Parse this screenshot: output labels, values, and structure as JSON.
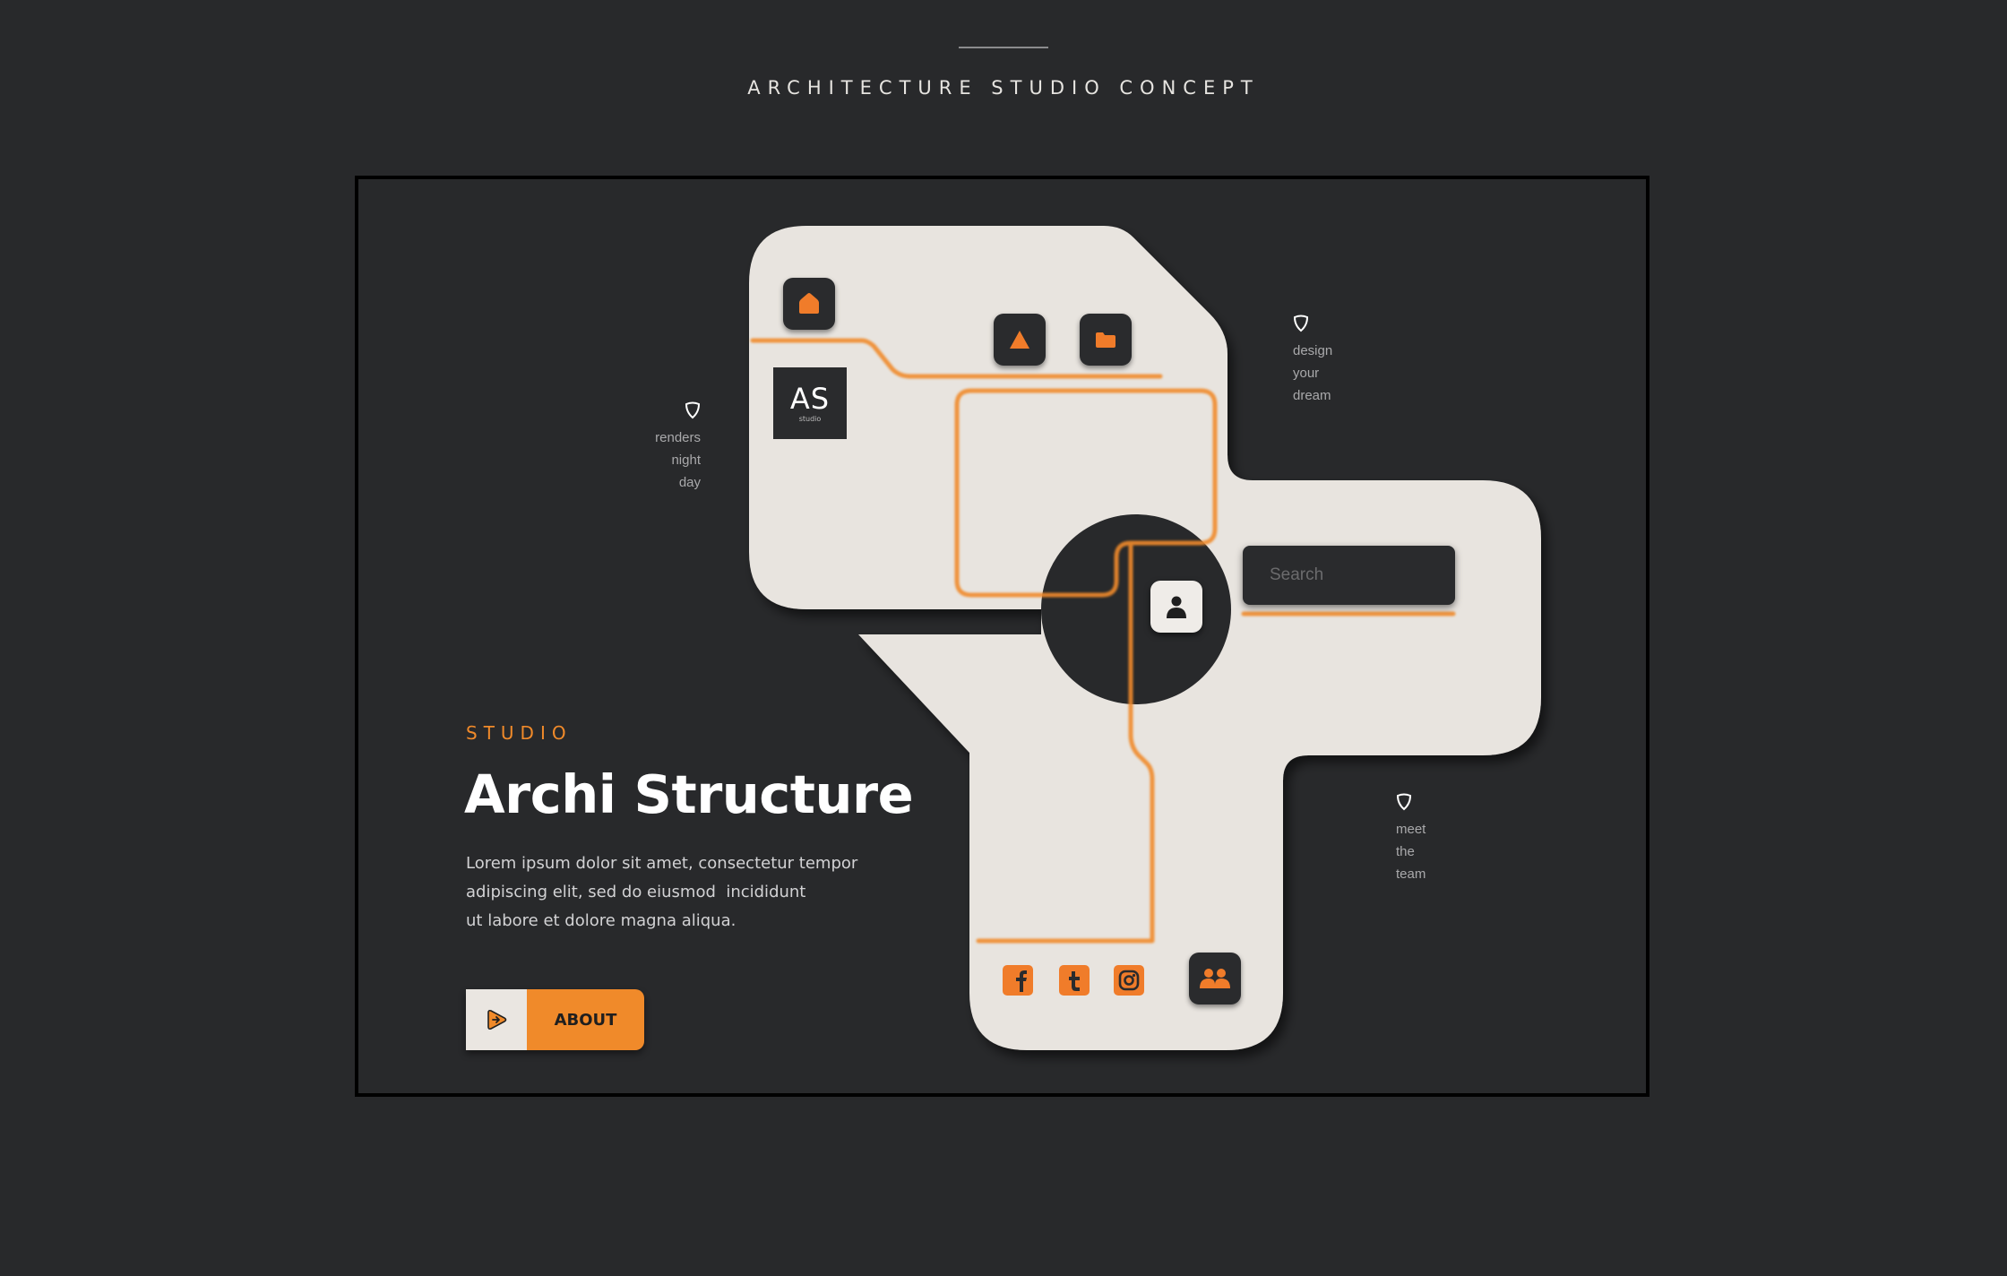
{
  "page": {
    "title": "ARCHITECTURE STUDIO CONCEPT"
  },
  "logo": {
    "initials": "AS",
    "subtitle": "studio"
  },
  "notes": {
    "left": [
      "renders",
      "night",
      "day"
    ],
    "top_right": [
      "design",
      "your",
      "dream"
    ],
    "bottom_right": [
      "meet",
      "the",
      "team"
    ]
  },
  "search": {
    "placeholder": "Search",
    "value": ""
  },
  "hero": {
    "kicker": "STUDIO",
    "title": "Archi Structure",
    "body": [
      "Lorem ipsum dolor sit amet, consectetur tempor",
      "adipiscing elit, sed do eiusmod  incididunt",
      "ut labore et dolore magna aliqua."
    ]
  },
  "about_button": {
    "label": "ABOUT"
  },
  "icons": {
    "home": "home-icon",
    "triangle": "triangle-icon",
    "folder": "folder-icon",
    "user": "user-icon",
    "team": "team-icon",
    "facebook": "facebook-icon",
    "tumblr": "tumblr-icon",
    "instagram": "instagram-icon",
    "search": "search-icon",
    "pin": "pin-icon",
    "play": "play-icon"
  },
  "colors": {
    "background": "#28292b",
    "panel": "#e8e4df",
    "accent": "#f08a2a",
    "tile": "#2a2b2d",
    "text": "#ffffff"
  }
}
